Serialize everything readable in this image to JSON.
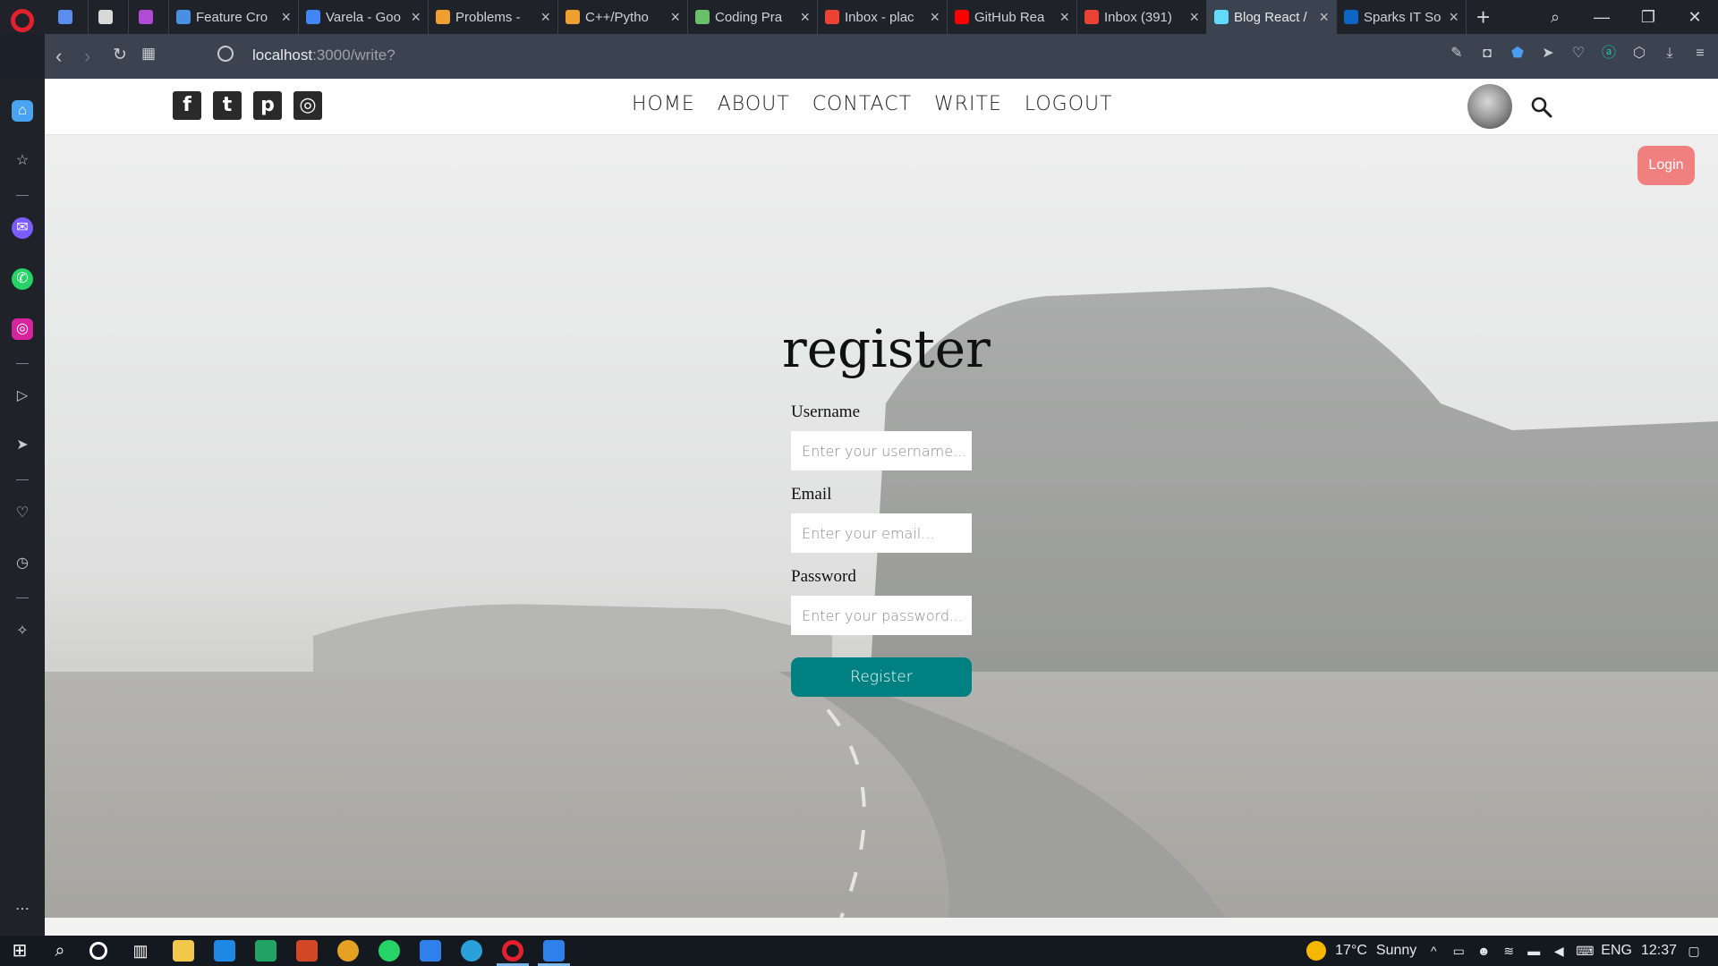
{
  "browser": {
    "tabs": [
      {
        "title": "",
        "icon": "chart-favicon",
        "color": "#5b8def",
        "small": true
      },
      {
        "title": "",
        "icon": "cc-favicon",
        "color": "#d9d9d9",
        "small": true
      },
      {
        "title": "",
        "icon": "m-favicon",
        "color": "#b04bd6",
        "small": true
      },
      {
        "title": "Feature Cro",
        "icon": "feature-favicon",
        "color": "#4a90e2"
      },
      {
        "title": "Varela - Goo",
        "icon": "google-fonts-favicon",
        "color": "#4285f4"
      },
      {
        "title": "Problems -",
        "icon": "problems-favicon",
        "color": "#f0a030"
      },
      {
        "title": "C++/Pytho",
        "icon": "code-favicon",
        "color": "#f0a030"
      },
      {
        "title": "Coding Pra",
        "icon": "coding-favicon",
        "color": "#6abf69"
      },
      {
        "title": "Inbox - plac",
        "icon": "gmail-favicon",
        "color": "#ea4335"
      },
      {
        "title": "GitHub Rea",
        "icon": "youtube-favicon",
        "color": "#ff0000"
      },
      {
        "title": "Inbox (391)",
        "icon": "gmail-favicon",
        "color": "#ea4335"
      },
      {
        "title": "Blog React /",
        "icon": "react-favicon",
        "color": "#61dafb",
        "active": true
      },
      {
        "title": "Sparks IT So",
        "icon": "linkedin-favicon",
        "color": "#0a66c2"
      }
    ],
    "url_host": "localhost",
    "url_path": ":3000/write?"
  },
  "page": {
    "nav": {
      "social": [
        {
          "name": "facebook-icon",
          "glyph": "f"
        },
        {
          "name": "twitter-icon",
          "glyph": "t"
        },
        {
          "name": "pinterest-icon",
          "glyph": "p"
        },
        {
          "name": "instagram-icon",
          "glyph": "◎"
        }
      ],
      "menu": [
        "HOME",
        "ABOUT",
        "CONTACT",
        "WRITE",
        "LOGOUT"
      ]
    },
    "login_button": "Login",
    "register": {
      "title": "register",
      "username_label": "Username",
      "username_placeholder": "Enter your username...",
      "email_label": "Email",
      "email_placeholder": "Enter your email...",
      "password_label": "Password",
      "password_placeholder": "Enter your password...",
      "submit_label": "Register"
    }
  },
  "taskbar": {
    "weather_temp": "17°C",
    "weather_text": "Sunny",
    "language": "ENG",
    "clock": "12:37"
  },
  "colors": {
    "accent_teal": "#008080",
    "login_pink": "#f08080"
  }
}
